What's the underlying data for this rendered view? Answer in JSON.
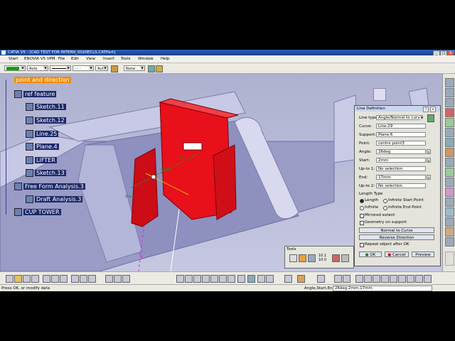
{
  "window": {
    "title": "CATIA V5 - [CAD TEST FOR INTERN_0020ECLS.CATPart]",
    "minimize": "_",
    "maximize": "□",
    "close": "X"
  },
  "menu": [
    "Start",
    "ENOVIA V5 VPM",
    "File",
    "Edit",
    "View",
    "Insert",
    "Tools",
    "Window",
    "Help"
  ],
  "toolbar": {
    "color": "",
    "layer_auto": "Auto",
    "linetype": "",
    "thickness": "- - -",
    "aut": "Aut",
    "none": "None"
  },
  "tree": {
    "nodes": [
      {
        "label": "point and direction",
        "highlight": true
      },
      {
        "label": "ref feature"
      },
      {
        "label": "Sketch.11"
      },
      {
        "label": "Sketch.12"
      },
      {
        "label": "Line.25"
      },
      {
        "label": "Plane.4"
      },
      {
        "label": "LIFTER"
      },
      {
        "label": "Sketch.13"
      },
      {
        "label": "Free Form Analysis.3"
      },
      {
        "label": "Draft Analysis.3"
      },
      {
        "label": "CUP TOWER"
      }
    ]
  },
  "model": {
    "label_start": "Start",
    "label_end": "End",
    "label_direction": "Angle"
  },
  "dialog": {
    "title": "Line Definition",
    "line_type_label": "Line type:",
    "line_type_value": "Angle/Normal to curve",
    "curve_label": "Curve:",
    "curve_value": "Line.29",
    "support_label": "Support:",
    "support_value": "Plane.6",
    "point_label": "Point:",
    "point_value": "centre point3",
    "angle_label": "Angle:",
    "angle_value": "26deg",
    "start_label": "Start:",
    "start_value": "2mm",
    "upto1_label": "Up-to 1:",
    "upto1_value": "No selection",
    "end_label": "End:",
    "end_value": "17mm",
    "upto2_label": "Up-to 2:",
    "upto2_value": "No selection",
    "length_type_label": "Length Type",
    "opt_length": "Length",
    "opt_inf_start": "Infinite Start Point",
    "opt_infinite": "Infinite",
    "opt_inf_end": "Infinite End Point",
    "mirrored": "Mirrored extent",
    "geom_support": "Geometry on support",
    "normal_btn": "Normal to Curve",
    "reverse_btn": "Reverse Direction",
    "repeat": "Repeat object after OK",
    "ok": "OK",
    "cancel": "Cancel",
    "preview": "Preview"
  },
  "tools_panel": {
    "title": "Tools",
    "value1": "10.1",
    "value2": "10.0"
  },
  "status": {
    "left": "Press OK, or modify data",
    "param_label": "Angle,Start,End",
    "param_value": "26deg,2mm,17mm"
  },
  "colors": {
    "tree_bg": "#1d2a6b",
    "highlight": "#f08c00",
    "part_red": "#e8101a",
    "background": "#b9bcd9"
  },
  "icons": [
    "catia-logo-icon",
    "spec-tree-icon",
    "compass-icon"
  ]
}
